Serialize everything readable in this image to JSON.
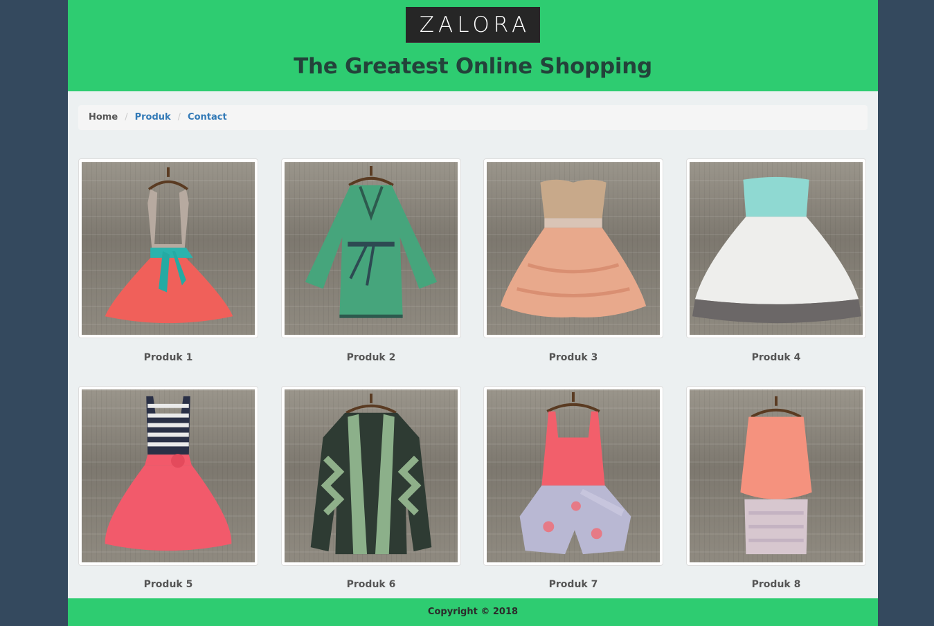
{
  "header": {
    "logo": "ZALORA",
    "tagline": "The Greatest Online Shopping"
  },
  "breadcrumb": {
    "items": [
      {
        "label": "Home",
        "active": true
      },
      {
        "label": "Produk",
        "active": false
      },
      {
        "label": "Contact",
        "active": false
      }
    ],
    "separator": "/"
  },
  "products": [
    {
      "name": "Produk 1",
      "image": "grey-tank-coral-skirt-teal-bow-dress"
    },
    {
      "name": "Produk 2",
      "image": "green-bell-sleeve-dress"
    },
    {
      "name": "Produk 3",
      "image": "sequin-peach-ruffle-dress"
    },
    {
      "name": "Produk 4",
      "image": "mint-white-grey-ruffle-dress"
    },
    {
      "name": "Produk 5",
      "image": "striped-top-coral-skirt-dress"
    },
    {
      "name": "Produk 6",
      "image": "green-aztec-cardigan"
    },
    {
      "name": "Produk 7",
      "image": "coral-top-floral-romper"
    },
    {
      "name": "Produk 8",
      "image": "peach-top-lace-skirt-dress"
    }
  ],
  "footer": {
    "copyright": "Copyright © 2018"
  },
  "colors": {
    "page_background": "#34495e",
    "header_green": "#2ecc71",
    "content_background": "#ecf0f1",
    "logo_background": "#262626",
    "link_blue": "#337ab7"
  }
}
